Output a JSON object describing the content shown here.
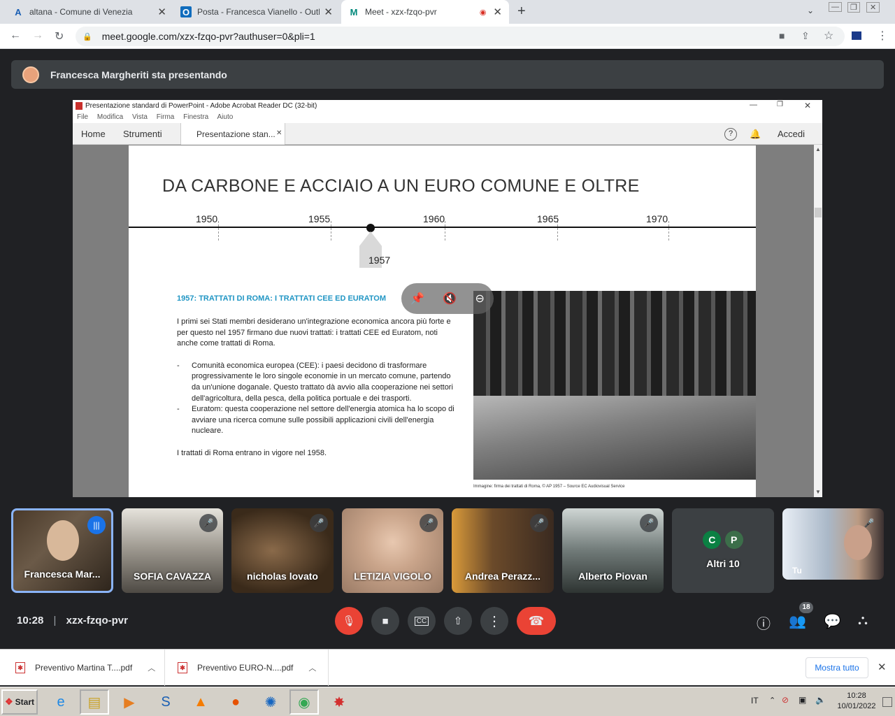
{
  "browser": {
    "tabs": [
      {
        "title": "altana - Comune di Venezia",
        "icon": "A"
      },
      {
        "title": "Posta - Francesca Vianello - Outlook",
        "icon": "O"
      },
      {
        "title": "Meet - xzx-fzqo-pvr",
        "icon": "M"
      }
    ],
    "url": "meet.google.com/xzx-fzqo-pvr?authuser=0&pli=1"
  },
  "meet": {
    "presenter_banner": "Francesca Margheriti sta presentando",
    "clock": "10:28",
    "meeting_code": "xzx-fzqo-pvr",
    "participants_count": "18",
    "others_label": "Altri 10",
    "others_initials": [
      "C",
      "P"
    ],
    "participants": [
      "Francesca Mar...",
      "SOFIA CAVAZZA",
      "nicholas lovato",
      "LETIZIA VIGOLO",
      "Andrea Perazz...",
      "Alberto Piovan"
    ],
    "self_label": "Tu"
  },
  "acrobat": {
    "window_title": "Presentazione standard di PowerPoint - Adobe Acrobat Reader DC (32-bit)",
    "menu": [
      "File",
      "Modifica",
      "Vista",
      "Firma",
      "Finestra",
      "Aiuto"
    ],
    "nav": {
      "home": "Home",
      "tools": "Strumenti",
      "doc_tab": "Presentazione stan...",
      "login": "Accedi"
    }
  },
  "slide": {
    "title": "DA CARBONE E ACCIAIO A UN EURO COMUNE E OLTRE",
    "timeline_years": [
      "1950",
      "1955",
      "1960",
      "1965",
      "1970"
    ],
    "marker_year": "1957",
    "heading": "1957: TRATTATI DI ROMA: I TRATTATI CEE ED EURATOM",
    "intro": "I primi sei Stati membri desiderano un'integrazione economica ancora più forte e per questo nel 1957 firmano due nuovi trattati: i trattati CEE ed Euratom, noti anche come trattati di Roma.",
    "bullets": [
      "Comunità economica europea (CEE): i paesi decidono di trasformare progressivamente le loro singole economie in un mercato comune, partendo da un'unione doganale. Questo trattato dà avvio alla cooperazione nei settori dell'agricoltura, della pesca, della politica portuale e dei trasporti.",
      "Euratom: questa cooperazione nel settore dell'energia atomica ha lo scopo di avviare una ricerca comune sulle possibili applicazioni civili dell'energia nucleare."
    ],
    "closing": "I trattati di Roma entrano in vigore nel 1958.",
    "caption": "Immagine: firma dei trattati di Roma, © AP 1957 – Source EC Audiovisual Service"
  },
  "downloads": {
    "items": [
      "Preventivo Martina T....pdf",
      "Preventivo  EURO-N....pdf"
    ],
    "show_all": "Mostra tutto"
  },
  "taskbar": {
    "start": "Start",
    "lang": "IT",
    "time": "10:28",
    "date": "10/01/2022"
  }
}
